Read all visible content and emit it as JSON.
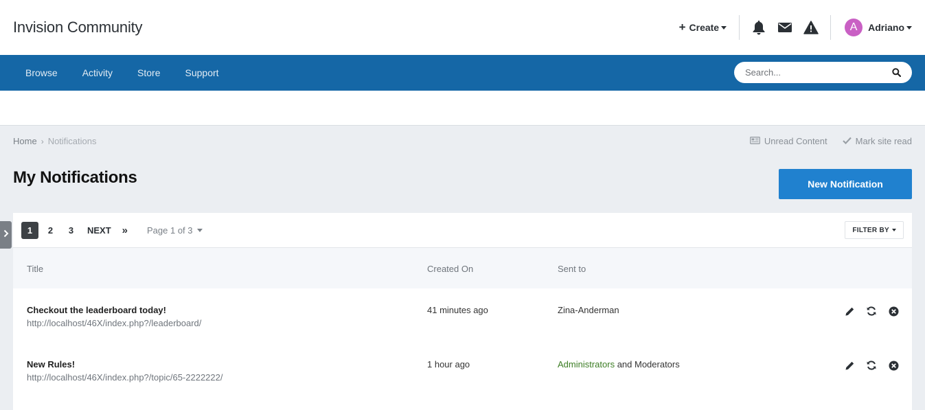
{
  "header": {
    "logo": "Invision Community",
    "create_label": "Create",
    "user_initial": "A",
    "user_name": "Adriano",
    "colors": {
      "avatar": "#c960c4",
      "nav": "#1567a6",
      "accent": "#2081cf"
    },
    "icons": [
      "plus-icon",
      "bell-icon",
      "envelope-icon",
      "warning-icon",
      "caret-down-icon"
    ]
  },
  "nav": {
    "items": [
      {
        "label": "Browse"
      },
      {
        "label": "Activity"
      },
      {
        "label": "Store"
      },
      {
        "label": "Support"
      }
    ],
    "search_placeholder": "Search..."
  },
  "breadcrumb": {
    "home": "Home",
    "current": "Notifications",
    "unread_content": "Unread Content",
    "mark_site_read": "Mark site read"
  },
  "page": {
    "title": "My Notifications",
    "new_button": "New Notification"
  },
  "pagination": {
    "pages": [
      "1",
      "2",
      "3"
    ],
    "active_page": "1",
    "next_label": "NEXT",
    "last_label": "»",
    "page_of": "Page 1 of 3",
    "filter_label": "FILTER BY"
  },
  "table": {
    "columns": [
      "Title",
      "Created On",
      "Sent to"
    ],
    "rows": [
      {
        "title": "Checkout the leaderboard today!",
        "url": "http://localhost/46X/index.php?/leaderboard/",
        "created": "41 minutes ago",
        "sent_to": "Zina-Anderman",
        "sent_to_group": "",
        "sent_to_rest": ""
      },
      {
        "title": "New Rules!",
        "url": "http://localhost/46X/index.php?/topic/65-2222222/",
        "created": "1 hour ago",
        "sent_to": "",
        "sent_to_group": "Administrators",
        "sent_to_rest": " and Moderators"
      }
    ]
  }
}
